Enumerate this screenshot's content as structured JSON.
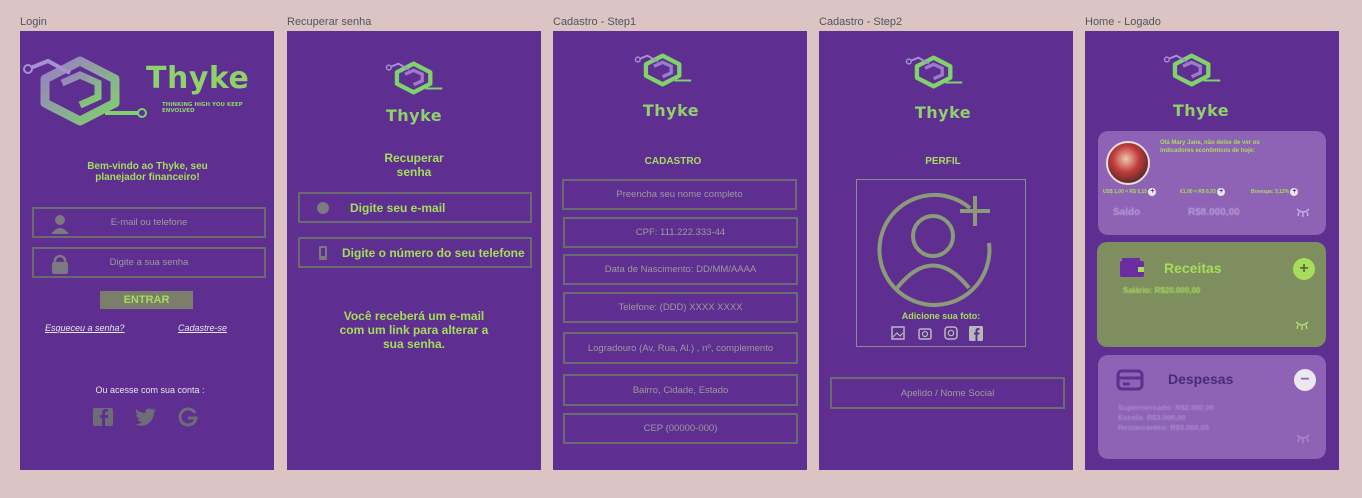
{
  "frames": {
    "login": {
      "label": "Login",
      "brand": "Thyke",
      "tagline": "THINKING HIGH YOU KEEP ENVOLVED",
      "welcome": "Bem-vindo ao Thyke, seu planejador financeiro!",
      "email_placeholder": "E-mail ou telefone",
      "password_placeholder": "Digite a sua senha",
      "enter_button": "ENTRAR",
      "forgot_link": "Esqueceu a senha?",
      "signup_link": "Cadastre-se",
      "social_prompt": "Ou acesse com sua conta :"
    },
    "recover": {
      "label": "Recuperar senha",
      "brand": "Thyke",
      "title_line1": "Recuperar",
      "title_line2": "senha",
      "email_option": "Digite seu e-mail",
      "phone_option": "Digite o número do seu telefone",
      "info": "Você receberá um e-mail com um link para alterar a sua senha."
    },
    "signup1": {
      "label": "Cadastro - Step1",
      "brand": "Thyke",
      "title": "CADASTRO",
      "fields": [
        "Preencha seu nome completo",
        "CPF: 111.222.333-44",
        "Data de Nascimento: DD/MM/AAAA",
        "Telefone:  (DDD) XXXX XXXX",
        "Logradouro (Av, Rua, Al.) , nº, complemento",
        "Bairro, Cidade, Estado",
        "CEP (00000-000)"
      ]
    },
    "signup2": {
      "label": "Cadastro - Step2",
      "brand": "Thyke",
      "title": "PERFIL",
      "add_photo": "Adicione sua foto:",
      "nickname_placeholder": "Apelido / Nome Social"
    },
    "home": {
      "label": "Home - Logado",
      "brand": "Thyke",
      "greeting": "Olá Mary Jane, não deixe de ver os indicadores econômicos de hoje:",
      "rates": [
        "US$ 1,00 = R$ 5,15",
        "€1,00 = R$ 6,93",
        "Bovespa: 3,12%"
      ],
      "balance_label": "Saldo",
      "balance_value": "R$8.000,00",
      "income_title": "Receitas",
      "income_item": "Salário: R$20.000,00",
      "expenses_title": "Despesas",
      "expense_items": [
        "Supermercado: R$2.000,00",
        "Escola: R$3.000,00",
        "Restaurantes: R$3.000,00"
      ]
    }
  },
  "colors": {
    "frame_bg": "#5e2f90",
    "accent_green": "#8fd16a",
    "page_bg": "#dcc4c4"
  }
}
